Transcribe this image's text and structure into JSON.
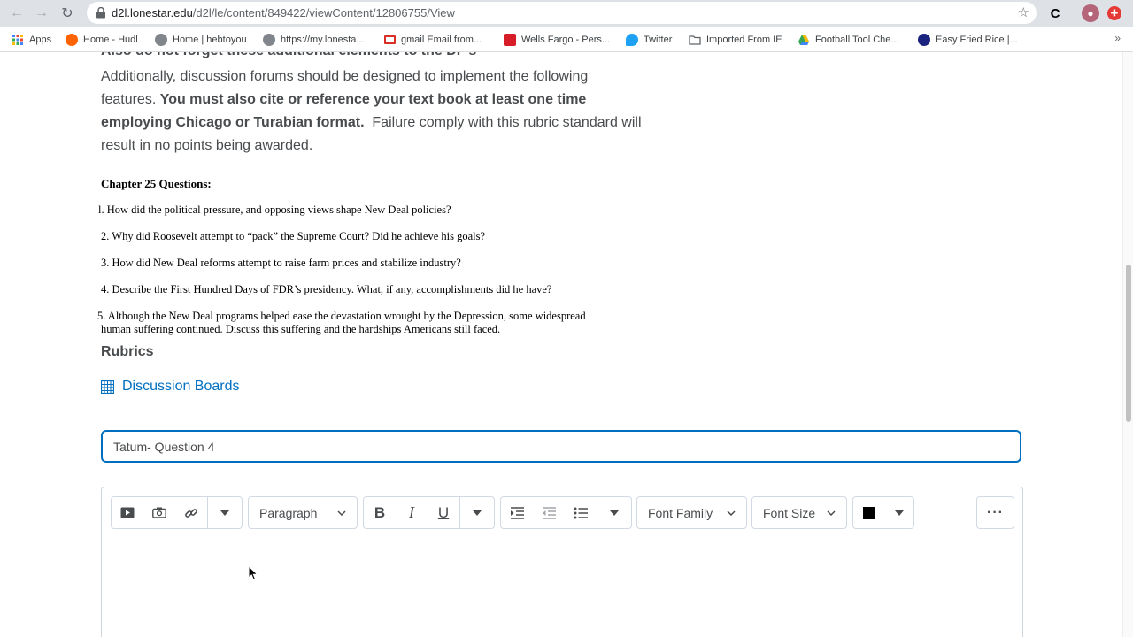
{
  "browser": {
    "url_host": "d2l.lonestar.edu",
    "url_path": "/d2l/le/content/849422/viewContent/12806755/View",
    "nav_back_icon": "arrow-left-icon",
    "nav_forward_icon": "arrow-right-icon",
    "reload_icon": "reload-icon",
    "bookmarks": [
      {
        "label": "Apps",
        "icon": "apps-grid-icon",
        "color": "#4285f4"
      },
      {
        "label": "Home - Hudl",
        "icon": "hudl-icon",
        "color": "#ff6300"
      },
      {
        "label": "Home | hebtoyou",
        "icon": "globe-icon",
        "color": "#5f6368"
      },
      {
        "label": "https://my.lonesta...",
        "icon": "globe-icon",
        "color": "#5f6368"
      },
      {
        "label": "gmail Email from...",
        "icon": "gmail-icon",
        "color": "#d93025"
      },
      {
        "label": "Wells Fargo - Pers...",
        "icon": "wells-fargo-icon",
        "color": "#d71e28"
      },
      {
        "label": "Twitter",
        "icon": "twitter-icon",
        "color": "#1da1f2"
      },
      {
        "label": "Imported From IE",
        "icon": "folder-icon",
        "color": "#5f6368"
      },
      {
        "label": "Football Tool Che...",
        "icon": "drive-icon",
        "color": "#34a853"
      },
      {
        "label": "Easy Fried Rice |...",
        "icon": "recipe-icon",
        "color": "#1a237e"
      }
    ]
  },
  "assignment": {
    "cut_heading": "Also do not forget these additional elements to the DF's-",
    "para_line1": "Additionally, discussion forums should be designed to implement the following",
    "para_line2_plain": "features. ",
    "para_line2_bold": "You must also cite or reference your text book at least one time",
    "para_line3_bold": "employing Chicago or Turabian format.",
    "para_line3_plain": "  Failure comply with this rubric standard will",
    "para_line4": "result in no points being awarded.",
    "questions_heading": "Chapter 25 Questions:",
    "questions": [
      "l. How did the political pressure, and opposing views shape New Deal policies?",
      "2. Why did Roosevelt attempt to “pack” the Supreme Court? Did he achieve his goals?",
      "3. How did New Deal reforms attempt to raise farm prices and stabilize industry?",
      "4. Describe the First Hundred Days of FDR’s presidency. What, if any, accomplishments did he have?"
    ],
    "question5_line1": "5. Although the New Deal programs helped ease the devastation wrought by the Depression, some widespread",
    "question5_line2": "human suffering continued. Discuss this suffering and the hardships Americans still faced."
  },
  "rubrics": {
    "heading": "Rubrics",
    "link_label": "Discussion Boards"
  },
  "post": {
    "subject_value": "Tatum- Question 4"
  },
  "toolbar": {
    "block_format": "Paragraph",
    "font_family": "Font Family",
    "font_size": "Font Size",
    "text_color": "#000000"
  },
  "colors": {
    "accent": "#006fbf",
    "text": "#494c4e"
  }
}
